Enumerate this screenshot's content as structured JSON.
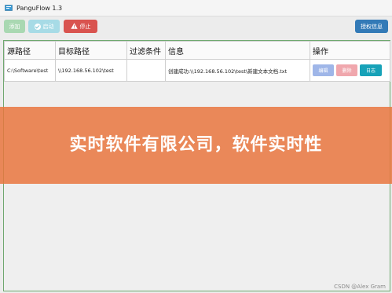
{
  "window": {
    "title": "PanguFlow 1.3"
  },
  "toolbar": {
    "add_label": "添加",
    "start_label": "启动",
    "stop_label": "停止",
    "license_label": "授权信息"
  },
  "table": {
    "columns": [
      "源路径",
      "目标路径",
      "过滤条件",
      "信息",
      "操作"
    ],
    "rows": [
      {
        "source": "C:\\Software\\test",
        "target": "\\\\192.168.56.102\\test",
        "filter": "",
        "info": "创建成功:\\\\192.168.56.102\\test\\新建文本文档.txt",
        "edit_label": "编辑",
        "delete_label": "删除",
        "log_label": "日志"
      }
    ]
  },
  "banner": {
    "text": "实时软件有限公司，软件实时性"
  },
  "watermark": "CSDN @Alex Gram",
  "colors": {
    "add": "#a9d8b2",
    "start": "#a7dbe6",
    "stop": "#d9534f",
    "license": "#337ab7",
    "edit": "#9fb6e8",
    "delete": "#f0a7ad",
    "log": "#17a2b8",
    "banner": "#e9763e"
  }
}
